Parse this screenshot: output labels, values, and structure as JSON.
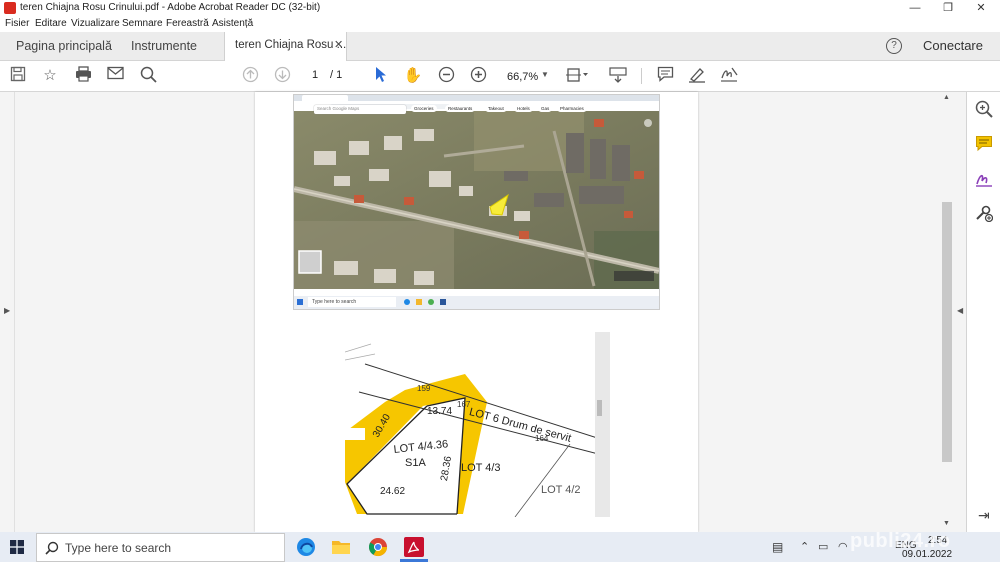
{
  "window": {
    "title": "teren Chiajna Rosu Crinului.pdf - Adobe Acrobat Reader DC (32-bit)"
  },
  "menu": [
    "Fisier",
    "Editare",
    "Vizualizare",
    "Semnare",
    "Fereastră",
    "Asistență"
  ],
  "tabs": {
    "home": "Pagina principală",
    "tools": "Instrumente",
    "document": "teren Chiajna Rosu ..."
  },
  "header": {
    "signin": "Conectare"
  },
  "toolbar": {
    "page_current": "1",
    "page_total": "/ 1",
    "zoom": "66,7%"
  },
  "map": {
    "search_placeholder": "Search Google Maps",
    "chips": [
      "Groceries",
      "Restaurants",
      "Takeout",
      "Hotels",
      "Gas",
      "Pharmacies"
    ],
    "taskbar_search": "Type here to search"
  },
  "plan": {
    "lot_main": "LOT 4/4.36",
    "lot_sub": "S1A",
    "lot_right": "LOT 4/3",
    "lot_far": "LOT 4/2",
    "road": "LOT 6 Drum de servit",
    "dims": [
      "13.74",
      "30.40",
      "28.36",
      "24.62"
    ],
    "points": [
      "159",
      "167",
      "164"
    ]
  },
  "taskbar": {
    "search_text": "Type here to search",
    "time": "2:54",
    "date": "09.01.2022",
    "lang": "ENG"
  },
  "watermark": "publi24.ro"
}
